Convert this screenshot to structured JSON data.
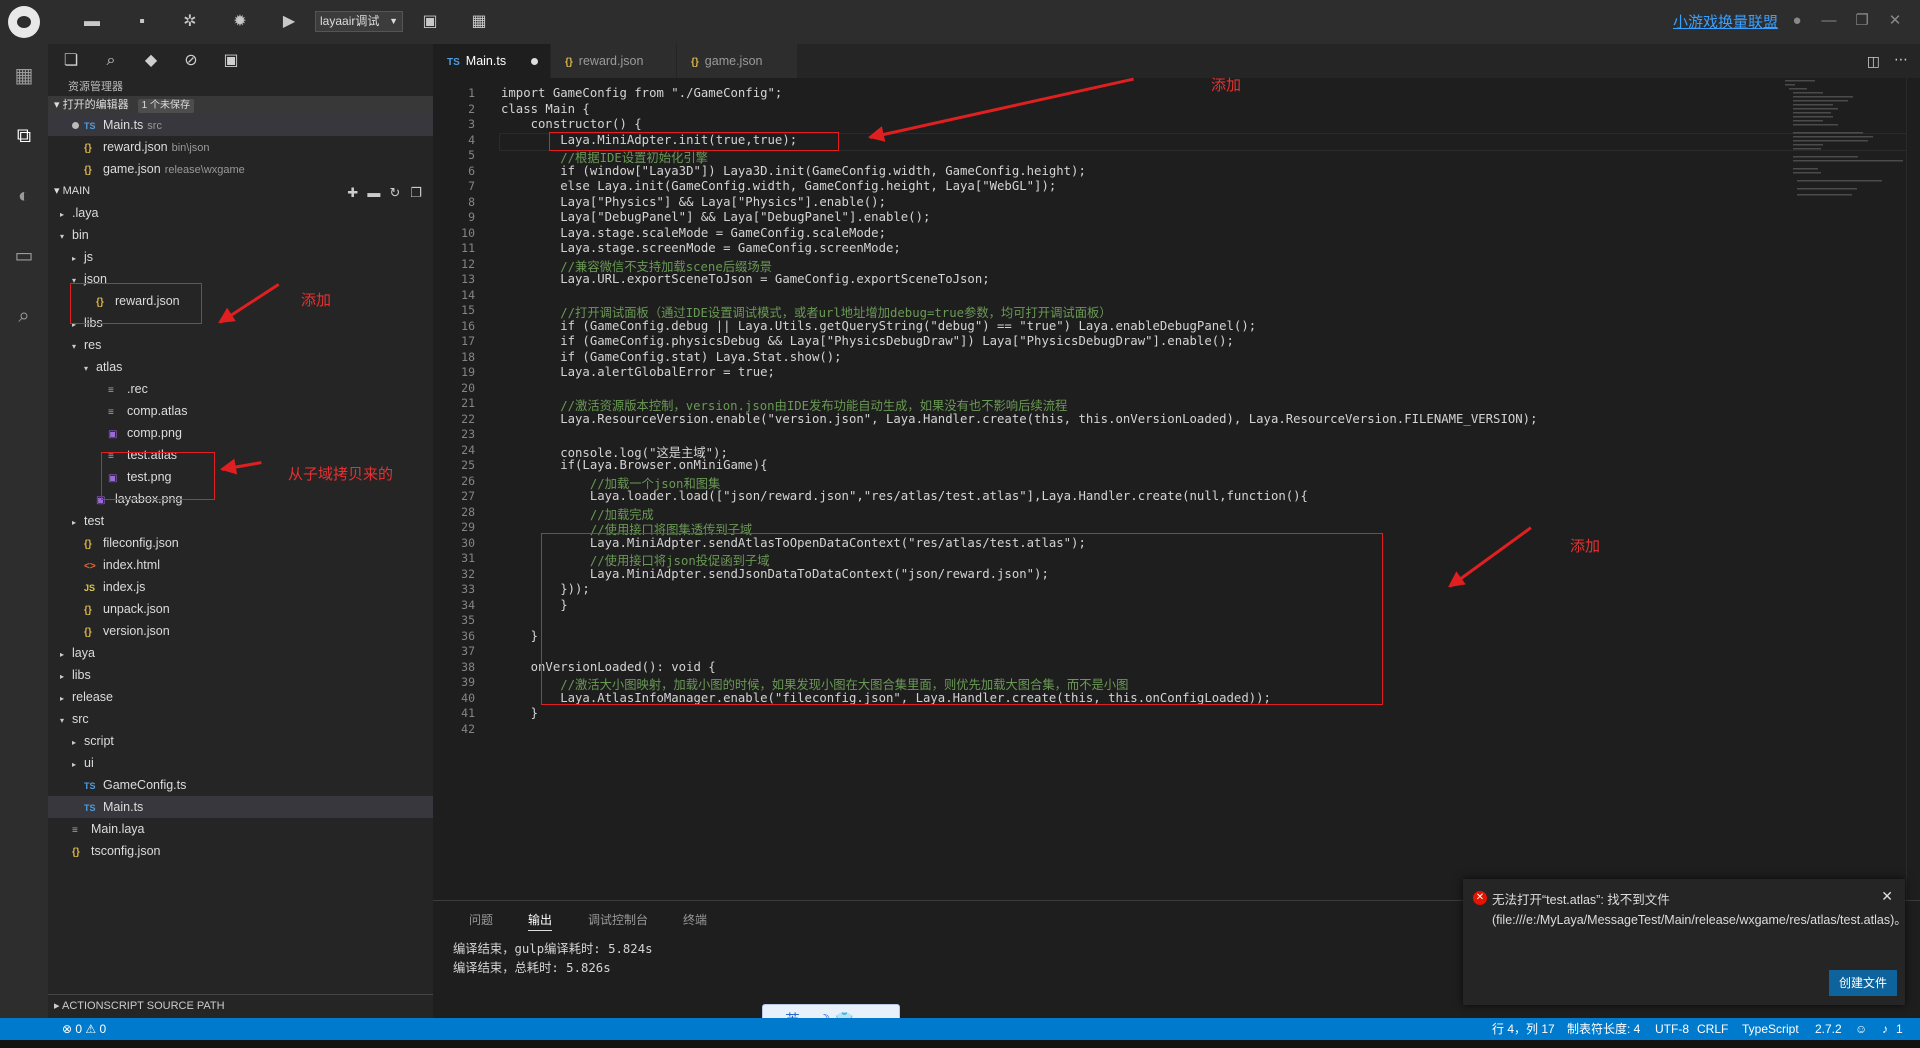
{
  "titlebar": {
    "run_config": "layaair调试",
    "brand_link": "小游戏换量联盟"
  },
  "sidebar": {
    "title": "资源管理器",
    "open_editors_label": "打开的编辑器",
    "unsaved_badge": "1 个未保存",
    "open_editors": [
      {
        "name": "Main.ts",
        "path": "src",
        "icon": "TS"
      },
      {
        "name": "reward.json",
        "path": "bin\\json",
        "icon": "{}"
      },
      {
        "name": "game.json",
        "path": "release\\wxgame",
        "icon": "{}"
      }
    ],
    "main_label": "MAIN",
    "tree": [
      {
        "label": ".laya",
        "icon": "",
        "arrow": "▸"
      },
      {
        "label": "bin",
        "icon": "",
        "arrow": "▾"
      },
      {
        "label": "js",
        "icon": "",
        "arrow": "▸"
      },
      {
        "label": "json",
        "icon": "",
        "arrow": "▾"
      },
      {
        "label": "reward.json",
        "icon": "{}"
      },
      {
        "label": "libs",
        "icon": "",
        "arrow": "▸"
      },
      {
        "label": "res",
        "icon": "",
        "arrow": "▾"
      },
      {
        "label": "atlas",
        "icon": "",
        "arrow": "▾"
      },
      {
        "label": ".rec",
        "icon": "≡"
      },
      {
        "label": "comp.atlas",
        "icon": "≡"
      },
      {
        "label": "comp.png",
        "icon": "▣"
      },
      {
        "label": "test.atlas",
        "icon": "≡"
      },
      {
        "label": "test.png",
        "icon": "▣"
      },
      {
        "label": "layabox.png",
        "icon": "▣"
      },
      {
        "label": "test",
        "icon": "",
        "arrow": "▸"
      },
      {
        "label": "fileconfig.json",
        "icon": "{}"
      },
      {
        "label": "index.html",
        "icon": "<>"
      },
      {
        "label": "index.js",
        "icon": "JS"
      },
      {
        "label": "unpack.json",
        "icon": "{}"
      },
      {
        "label": "version.json",
        "icon": "{}"
      },
      {
        "label": "laya",
        "icon": "",
        "arrow": "▸"
      },
      {
        "label": "libs",
        "icon": "",
        "arrow": "▸"
      },
      {
        "label": "release",
        "icon": "",
        "arrow": "▸"
      },
      {
        "label": "src",
        "icon": "",
        "arrow": "▾"
      },
      {
        "label": "script",
        "icon": "",
        "arrow": "▸"
      },
      {
        "label": "ui",
        "icon": "",
        "arrow": "▸"
      },
      {
        "label": "GameConfig.ts",
        "icon": "TS"
      },
      {
        "label": "Main.ts",
        "icon": "TS"
      },
      {
        "label": "Main.laya",
        "icon": "≡"
      },
      {
        "label": "tsconfig.json",
        "icon": "{}"
      }
    ],
    "actionscript_path": "ACTIONSCRIPT SOURCE PATH"
  },
  "tabs": [
    {
      "label": "Main.ts",
      "icon": "TS"
    },
    {
      "label": "reward.json",
      "icon": "{}"
    },
    {
      "label": "game.json",
      "icon": "{}"
    }
  ],
  "code_lines": [
    "import GameConfig from \"./GameConfig\";",
    "class Main {",
    "    constructor() {",
    "        Laya.MiniAdpter.init(true,true);",
    "        //根据IDE设置初始化引擎",
    "        if (window[\"Laya3D\"]) Laya3D.init(GameConfig.width, GameConfig.height);",
    "        else Laya.init(GameConfig.width, GameConfig.height, Laya[\"WebGL\"]);",
    "        Laya[\"Physics\"] && Laya[\"Physics\"].enable();",
    "        Laya[\"DebugPanel\"] && Laya[\"DebugPanel\"].enable();",
    "        Laya.stage.scaleMode = GameConfig.scaleMode;",
    "        Laya.stage.screenMode = GameConfig.screenMode;",
    "        //兼容微信不支持加载scene后缀场景",
    "        Laya.URL.exportSceneToJson = GameConfig.exportSceneToJson;",
    "",
    "        //打开调试面板（通过IDE设置调试模式，或者url地址增加debug=true参数，均可打开调试面板）",
    "        if (GameConfig.debug || Laya.Utils.getQueryString(\"debug\") == \"true\") Laya.enableDebugPanel();",
    "        if (GameConfig.physicsDebug && Laya[\"PhysicsDebugDraw\"]) Laya[\"PhysicsDebugDraw\"].enable();",
    "        if (GameConfig.stat) Laya.Stat.show();",
    "        Laya.alertGlobalError = true;",
    "",
    "        //激活资源版本控制，version.json由IDE发布功能自动生成，如果没有也不影响后续流程",
    "        Laya.ResourceVersion.enable(\"version.json\", Laya.Handler.create(this, this.onVersionLoaded), Laya.ResourceVersion.FILENAME_VERSION);",
    "",
    "        console.log(\"这是主域\");",
    "        if(Laya.Browser.onMiniGame){",
    "            //加载一个json和图集",
    "            Laya.loader.load([\"json/reward.json\",\"res/atlas/test.atlas\"],Laya.Handler.create(null,function(){",
    "            //加载完成",
    "            //使用接口将图集透传到子域",
    "            Laya.MiniAdpter.sendAtlasToOpenDataContext(\"res/atlas/test.atlas\");",
    "            //使用接口将json投促函到子域",
    "            Laya.MiniAdpter.sendJsonDataToDataContext(\"json/reward.json\");",
    "        }));",
    "        }",
    "",
    "    }",
    "",
    "    onVersionLoaded(): void {",
    "        //激活大小图映射，加载小图的时候，如果发现小图在大图合集里面，则优先加载大图合集，而不是小图",
    "        Laya.AtlasInfoManager.enable(\"fileconfig.json\", Laya.Handler.create(this, this.onConfigLoaded));",
    "    }",
    ""
  ],
  "annotations": {
    "add_top": "添加",
    "add_sidebar": "添加",
    "copied": "从子域拷贝来的",
    "add_right": "添加"
  },
  "panel": {
    "tabs": [
      "问题",
      "输出",
      "调试控制台",
      "终端"
    ],
    "output": [
      "编译结束，gulp编译耗时: 5.824s",
      "编译结束，总耗时: 5.826s"
    ]
  },
  "notification": {
    "message": "无法打开“test.atlas”: 找不到文件(file:///e:/MyLaya/MessageTest/Main/release/wxgame/res/atlas/test.atlas)。",
    "button": "创建文件"
  },
  "statusbar": {
    "problems": "⊗ 0 ⚠ 0",
    "position": "行 4，列 17",
    "tab_size": "制表符长度: 4",
    "encoding": "UTF-8",
    "eol": "CRLF",
    "language": "TypeScript",
    "version": "2.7.2",
    "notifications": "1"
  },
  "ime": {
    "label": "英 ·, ☽ 👕"
  }
}
